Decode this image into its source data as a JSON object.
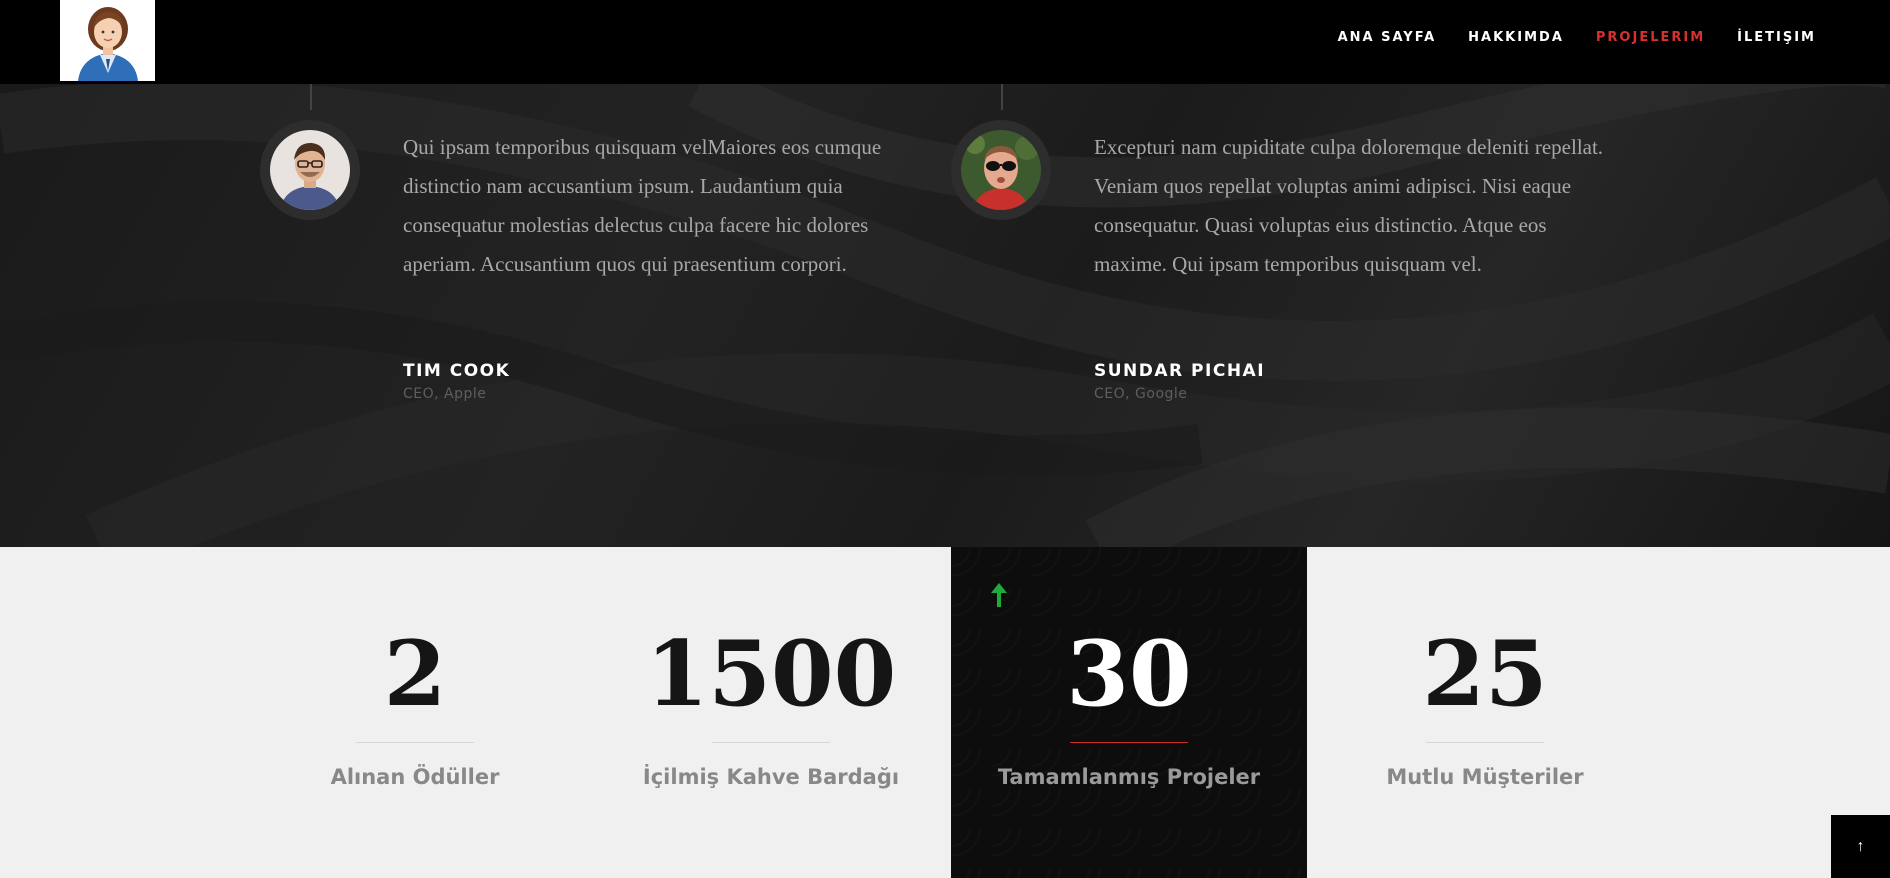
{
  "nav": {
    "items": [
      {
        "label": "ANA SAYFA",
        "active": false
      },
      {
        "label": "HAKKIMDA",
        "active": false
      },
      {
        "label": "PROJELERIM",
        "active": true
      },
      {
        "label": "İLETIŞIM",
        "active": false
      }
    ],
    "accent_color": "#d9302f"
  },
  "testimonials": [
    {
      "quote": "Qui ipsam temporibus quisquam velMaiores eos cumque distinctio nam accusantium ipsum. Laudantium quia consequatur molestias delectus culpa facere hic dolores aperiam. Accusantium quos qui praesentium corpori.",
      "name": "TIM COOK",
      "role": "CEO, Apple"
    },
    {
      "quote": "Excepturi nam cupiditate culpa doloremque deleniti repellat. Veniam quos repellat voluptas animi adipisci. Nisi eaque consequatur. Quasi voluptas eius distinctio. Atque eos maxime. Qui ipsam temporibus quisquam vel.",
      "name": "SUNDAR PICHAI",
      "role": "CEO, Google"
    }
  ],
  "stats": [
    {
      "value": "2",
      "label": "Alınan Ödüller"
    },
    {
      "value": "1500",
      "label": "İçilmiş Kahve Bardağı"
    },
    {
      "value": "30",
      "label": "Tamamlanmış Projeler"
    },
    {
      "value": "25",
      "label": "Mutlu Müşteriler"
    }
  ],
  "icons": {
    "logo": "female-avatar-icon",
    "highlight": "arrow-up-icon",
    "back_to_top": "arrow-up-icon"
  },
  "back_to_top_glyph": "↑"
}
